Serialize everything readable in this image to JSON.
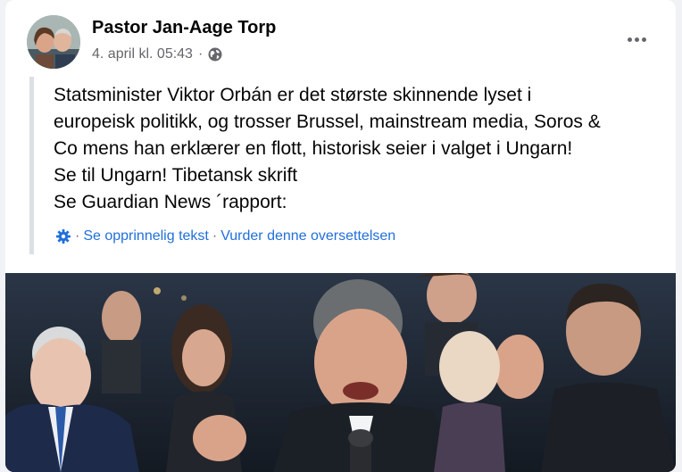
{
  "post": {
    "author": "Pastor Jan-Aage Torp",
    "timestamp": "4. april kl. 05:43",
    "visibility_icon": "globe-icon",
    "menu_icon": "more-horizontal-icon",
    "text_lines": [
      "Statsminister Viktor Orbán er det største skinnende lyset i",
      "europeisk politikk, og trosser Brussel, mainstream media, Soros &",
      "Co mens han erklærer en flott, historisk seier i valget i Ungarn!",
      "Se til Ungarn! Tibetansk skrift",
      "Se Guardian News ´rapport:"
    ],
    "translation": {
      "settings_icon": "gear-icon",
      "separator": "·",
      "see_original": "Se opprinnelig tekst",
      "rate_translation": "Vurder denne oversettelsen"
    }
  },
  "colors": {
    "link": "#216fdb",
    "secondary_text": "#65676b",
    "primary_text": "#050505"
  }
}
